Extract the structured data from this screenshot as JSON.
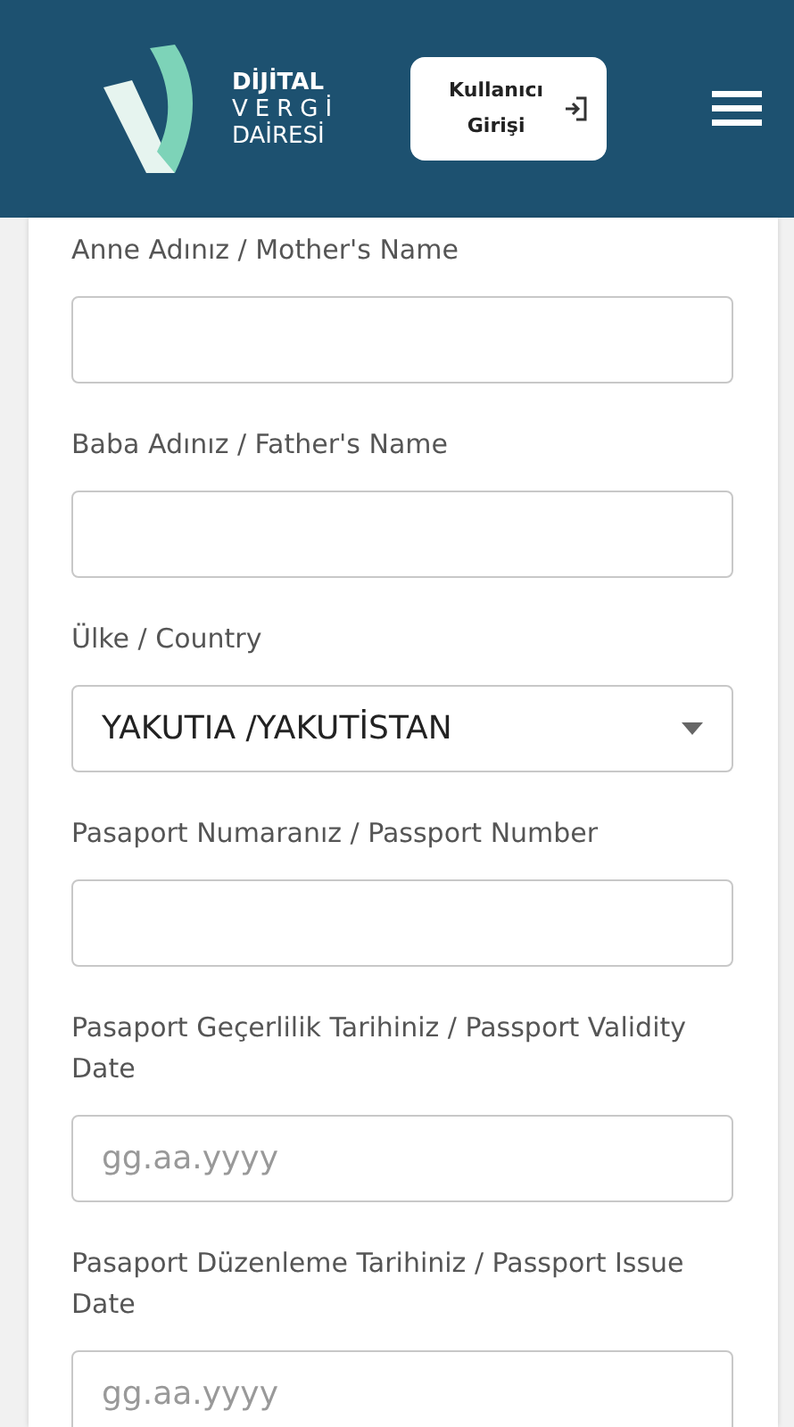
{
  "header": {
    "logo_lines": [
      "DİJİTAL",
      "VERGİ",
      "DAİRESİ"
    ],
    "login_button": "Kullanıcı Girişi"
  },
  "fields": [
    {
      "kind": "text",
      "label": "Anne Adınız / Mother's Name"
    },
    {
      "kind": "text",
      "label": "Baba Adınız / Father's Name"
    },
    {
      "kind": "select",
      "label": "Ülke / Country",
      "value": "YAKUTIA /YAKUTİSTAN"
    },
    {
      "kind": "text",
      "label": "Pasaport Numaranız / Passport Number"
    },
    {
      "kind": "date",
      "label": "Pasaport Geçerlilik Tarihiniz / Passport Validity Date",
      "placeholder": "gg.aa.yyyy"
    },
    {
      "kind": "date",
      "label": "Pasaport Düzenleme Tarihiniz / Passport Issue Date",
      "placeholder": "gg.aa.yyyy"
    }
  ]
}
